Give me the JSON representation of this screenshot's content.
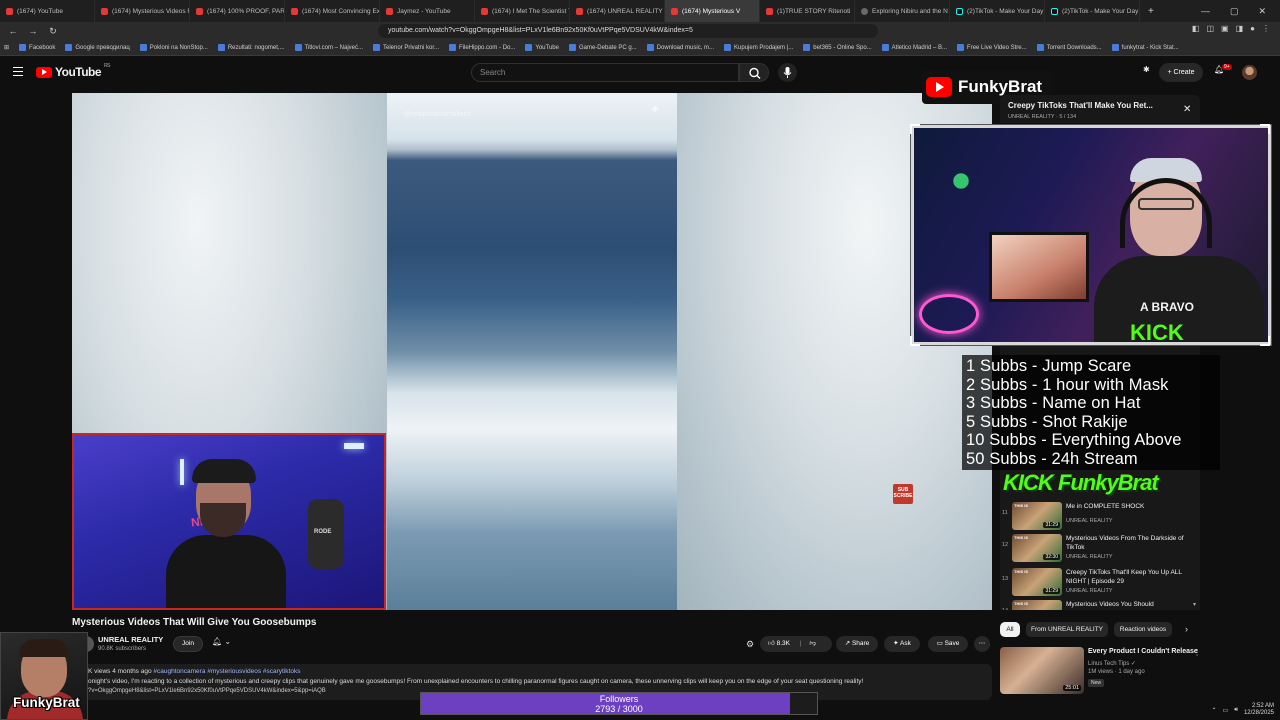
{
  "browser": {
    "tabs": [
      {
        "label": "(1674) YouTube",
        "active": false
      },
      {
        "label": "(1674) Mysterious Videos F",
        "active": false
      },
      {
        "label": "(1674) 100% PROOF, PARA",
        "active": false
      },
      {
        "label": "(1674) Most Convincing Ex",
        "active": false
      },
      {
        "label": "Jaymez - YouTube",
        "active": false
      },
      {
        "label": "(1674) I Met The Scientist T",
        "active": false
      },
      {
        "label": "(1674) UNREAL REALITY - Y",
        "active": false
      },
      {
        "label": "(1674) Mysterious V",
        "active": true
      },
      {
        "label": "(1)TRUE STORY Ritenoti",
        "active": false
      },
      {
        "label": "Exploring Nibiru and the N",
        "active": false
      },
      {
        "label": "(2)TikTok - Make Your Day",
        "active": false
      },
      {
        "label": "(2)TikTok - Make Your Day",
        "active": false
      }
    ],
    "url": "youtube.com/watch?v=OkggOmpgeH8&list=PLxV1le6Bn92x50Kf0uVtPPqe5VDSUV4kW&index=5",
    "bookmarks": [
      "Facebook",
      "Google преводилац",
      "Pokloni na NonStop...",
      "Rezultati: nogomet,...",
      "Titlovi.com – Najveć...",
      "Telenor Privatni kor...",
      "FileHippo.com - Do...",
      "YouTube",
      "Game-Debate PC g...",
      "Download music, m...",
      "Kupujem Prodajem |...",
      "bet365 - Online Spo...",
      "Atletico Madrid – B...",
      "Free Live Video Stre...",
      "Torrent Downloads...",
      "funkytrat - Kick Stat..."
    ]
  },
  "header": {
    "logo_text": "YouTube",
    "logo_region": "RS",
    "search_placeholder": "Search",
    "create_label": "+ Create",
    "notif_count": "9+"
  },
  "video": {
    "clip_handle": "@realparanormallens",
    "sub_badge": "SUB SCRIBE",
    "cam_left_shirt": "NELISTA",
    "cam_left_mic": "RODE",
    "title": "Mysterious Videos That Will Give You Goosebumps",
    "channel": "UNREAL REALITY",
    "subscribers": "90.8K subscribers",
    "join_label": "Join",
    "likes": "8.3K",
    "share_label": "Share",
    "ask_label": "Ask",
    "save_label": "Save",
    "meta": "K views  4 months ago",
    "meta_tags": "#caughtoncamera #mysteriousvideos #scarytiktoks",
    "description": "onight's video, I'm reacting to a collection of mysterious and creepy clips that genuinely gave me goosebumps! From unexplained encounters to chilling paranormal figures caught on camera, these unnerving clips will keep you on the edge of your seat questioning reality!",
    "desc_url": "?v=OkggOmpgeH8&list=PLxV1le6Bn92x50Kf0uVtPPqe5VDSUV4kW&index=5&pp=iAQB"
  },
  "overlay": {
    "brand": "FunkyBrat",
    "playlist_title": "Creepy TikToks That'll Make You Ret...",
    "playlist_sub": "UNREAL REALITY · 5 / 134",
    "cam_right_shirt": "A BRAVO",
    "cam_right_kick": "KICK",
    "goals": [
      "1 Subbs - Jump Scare",
      "2 Subbs - 1 hour with Mask",
      "3 Subbs - Name on Hat",
      "5 Subbs - Shot Rakije",
      "10 Subbs - Everything Above",
      "50 Subbs - 24h Stream"
    ],
    "kick_tag": "KICK FunkyBrat",
    "followers_label": "Followers",
    "followers_count": "2793 / 3000",
    "followers_progress": 0.931,
    "bottom_cam_label": "FunkyBrat"
  },
  "playlist": {
    "items": [
      {
        "num": "11",
        "label": "THIS IS",
        "duration": "31:29",
        "title": "Me in COMPLETE SHOCK",
        "channel": "UNREAL REALITY"
      },
      {
        "num": "12",
        "label": "THIS IS",
        "duration": "32:30",
        "title": "Mysterious Videos From The Darkside of TikTok",
        "channel": "UNREAL REALITY"
      },
      {
        "num": "13",
        "label": "THIS IS",
        "duration": "31:29",
        "title": "Creepy TikToks That'll Keep You Up ALL NIGHT | Episode 29",
        "channel": "UNREAL REALITY"
      },
      {
        "num": "14",
        "label": "THIS IS",
        "duration": "",
        "title": "Mysterious Videos You Should",
        "channel": ""
      }
    ]
  },
  "chips": [
    {
      "label": "All",
      "selected": true
    },
    {
      "label": "From UNREAL REALITY",
      "selected": false
    },
    {
      "label": "Reaction videos",
      "selected": false
    }
  ],
  "recommendation": {
    "title": "Every Product I Couldn't Release",
    "channel": "Linus Tech Tips",
    "meta": "1M views · 1 day ago",
    "badge": "New",
    "duration": "25:01"
  },
  "system": {
    "time": "2:52 AM",
    "date": "12/28/2025"
  }
}
